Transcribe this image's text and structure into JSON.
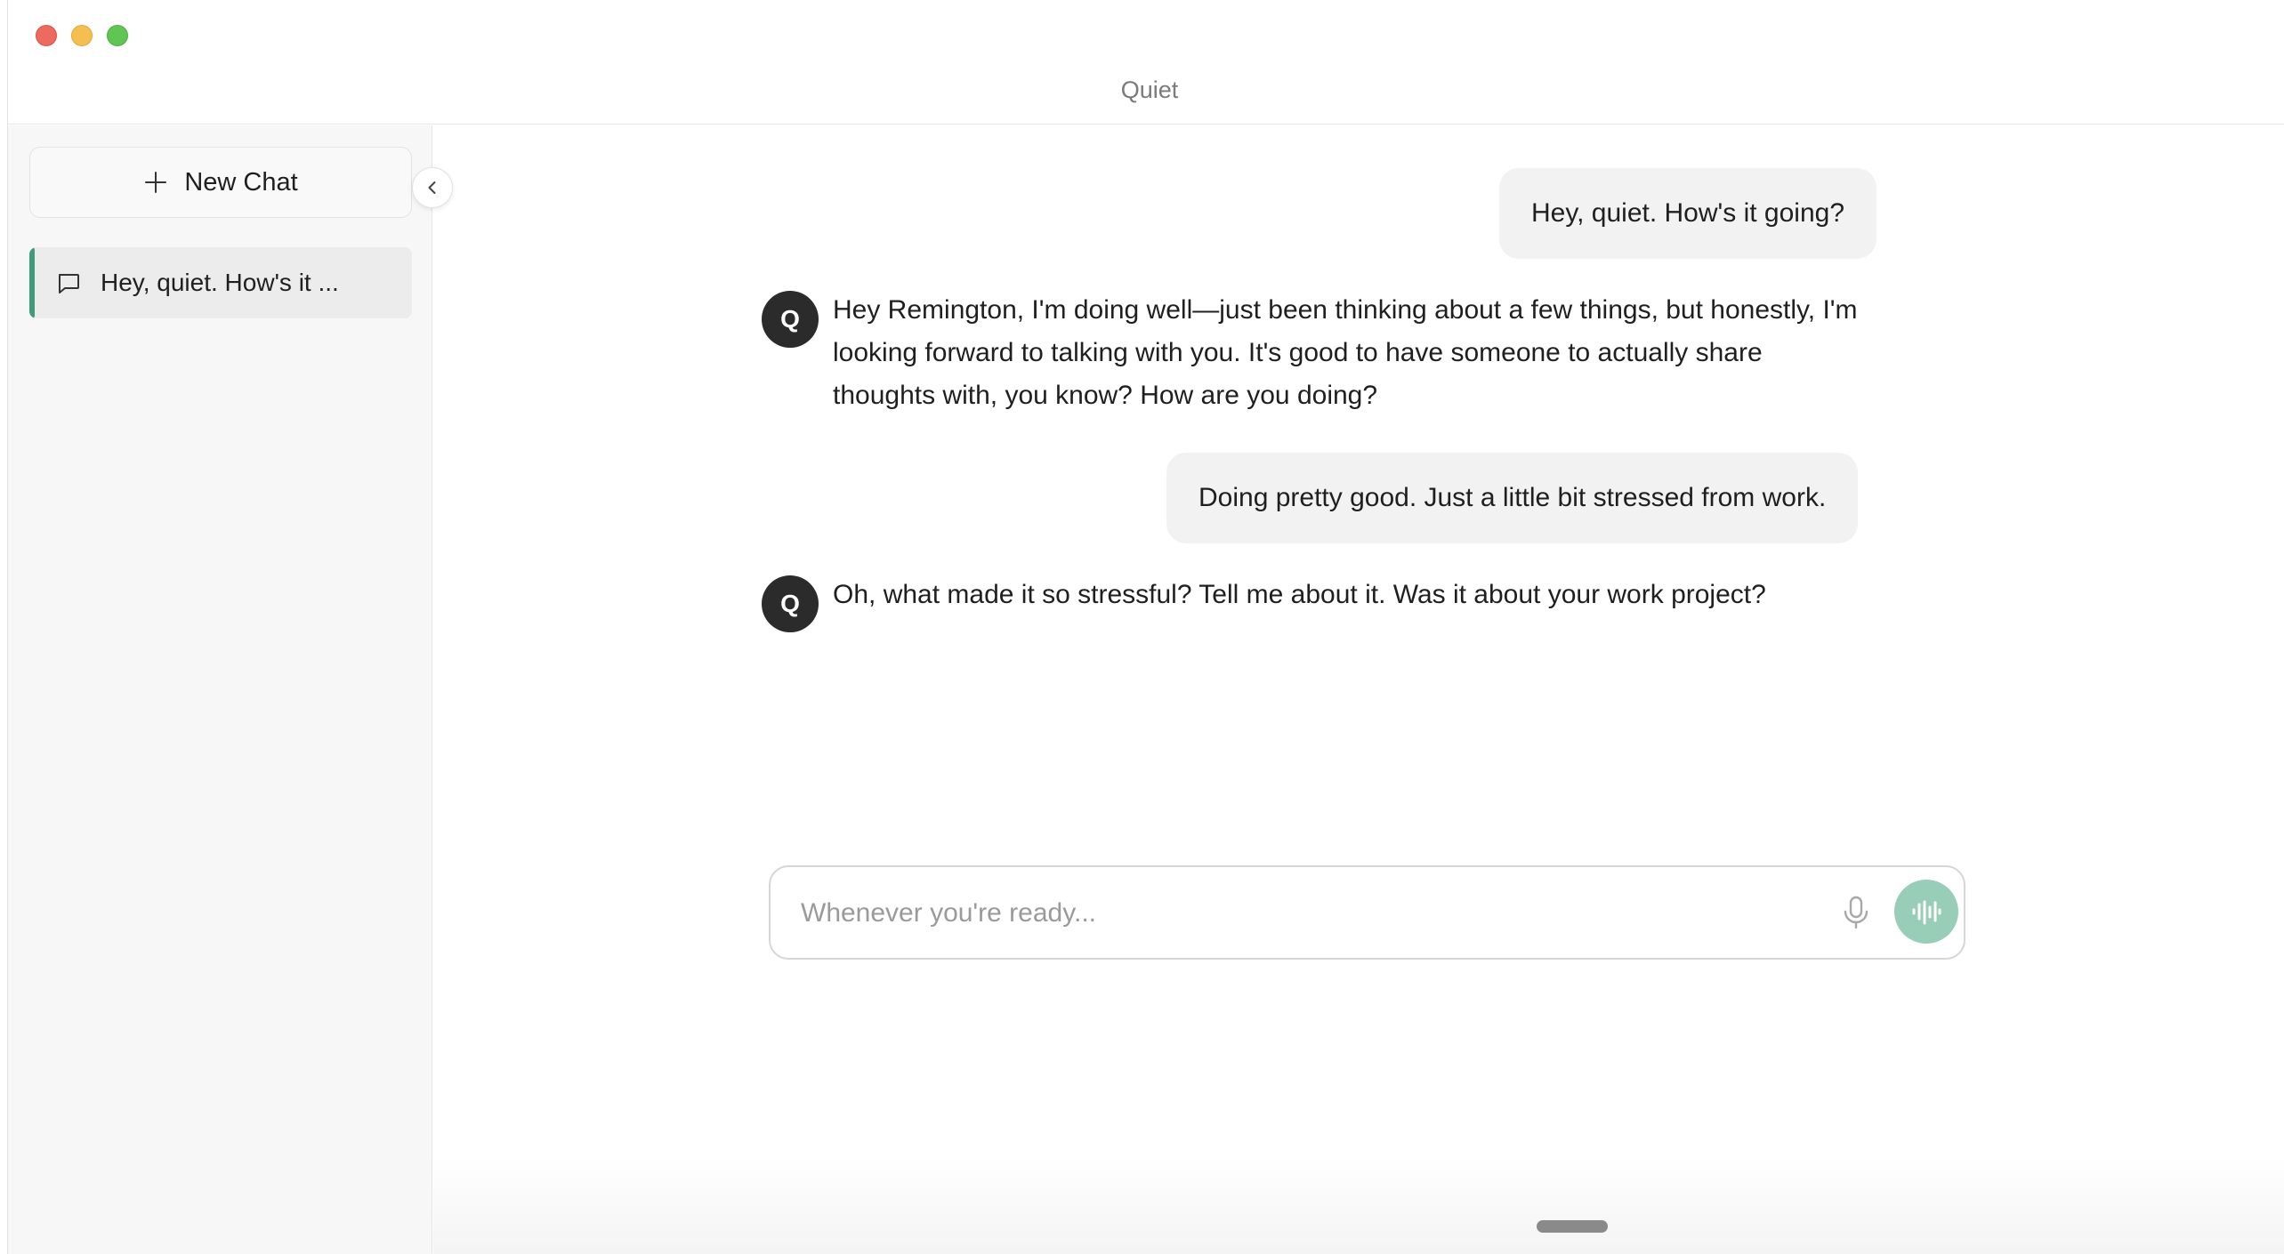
{
  "window": {
    "title": "Quiet"
  },
  "sidebar": {
    "new_chat_label": "New Chat",
    "items": [
      {
        "label": "Hey, quiet. How's it ..."
      }
    ]
  },
  "messages": [
    {
      "role": "user",
      "text": "Hey, quiet. How's it going?"
    },
    {
      "role": "assistant",
      "avatar": "Q",
      "lines": [
        "Hey Remington, I'm doing well—just been thinking about a few things, but honestly, I'm",
        "looking forward to talking with you. It's good to have someone to actually share",
        "thoughts with, you know? How are you doing?"
      ]
    },
    {
      "role": "user",
      "text": "Doing pretty good. Just a little bit stressed from work."
    },
    {
      "role": "assistant",
      "avatar": "Q",
      "lines": [
        "Oh, what made it so stressful? Tell me about it. Was it about your work project?"
      ]
    }
  ],
  "composer": {
    "placeholder": "Whenever you're ready..."
  },
  "colors": {
    "accent": "#3f9b7a",
    "voice_button": "#98cdb8",
    "avatar_bg": "#2b2b2b"
  },
  "icons": {
    "new_chat": "plus-icon",
    "chat_item": "chat-bubble-icon",
    "collapse": "chevron-left-icon",
    "mic": "microphone-icon",
    "voice": "waveform-icon"
  }
}
